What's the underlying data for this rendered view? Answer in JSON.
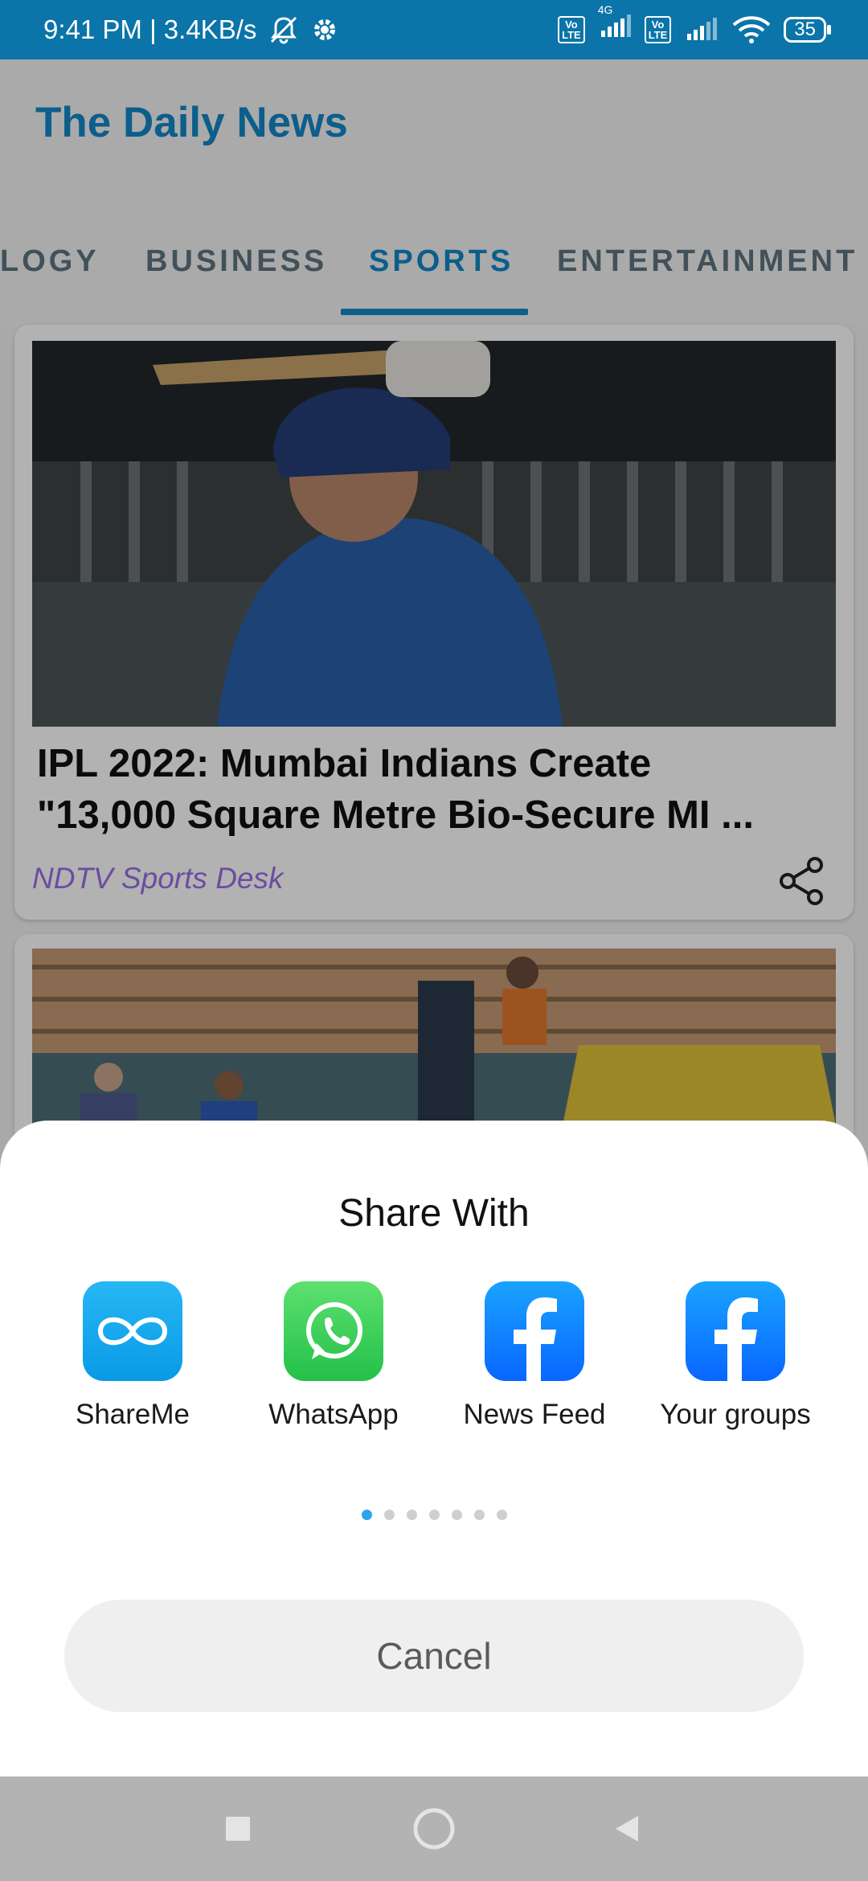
{
  "status_bar": {
    "time_speed": "9:41 PM | 3.4KB/s",
    "network_label": "4G",
    "battery_level": "35",
    "icons": [
      "mute-bell-icon",
      "gear-icon",
      "volte-icon",
      "signal-icon",
      "wifi-icon",
      "battery-icon"
    ]
  },
  "app": {
    "title": "The Daily News",
    "accent_color": "#1287c7"
  },
  "tabs": [
    {
      "label": "LOGY",
      "active": false
    },
    {
      "label": "BUSINESS",
      "active": false
    },
    {
      "label": "SPORTS",
      "active": true
    },
    {
      "label": "ENTERTAINMENT",
      "active": false
    }
  ],
  "articles": [
    {
      "headline_line1": "IPL 2022: Mumbai Indians Create",
      "headline_line2": "\"13,000 Square Metre Bio-Secure MI ...",
      "source": "NDTV Sports Desk",
      "share_icon": "share-icon"
    }
  ],
  "share_sheet": {
    "title": "Share With",
    "targets": [
      {
        "label": "ShareMe",
        "icon": "shareme-icon"
      },
      {
        "label": "WhatsApp",
        "icon": "whatsapp-icon"
      },
      {
        "label": "News Feed",
        "icon": "facebook-icon"
      },
      {
        "label": "Your groups",
        "icon": "facebook-icon"
      }
    ],
    "page_count": 7,
    "active_page": 1,
    "cancel_label": "Cancel"
  },
  "nav_bar": {
    "buttons": [
      "recents-square-icon",
      "home-circle-icon",
      "back-triangle-icon"
    ]
  }
}
